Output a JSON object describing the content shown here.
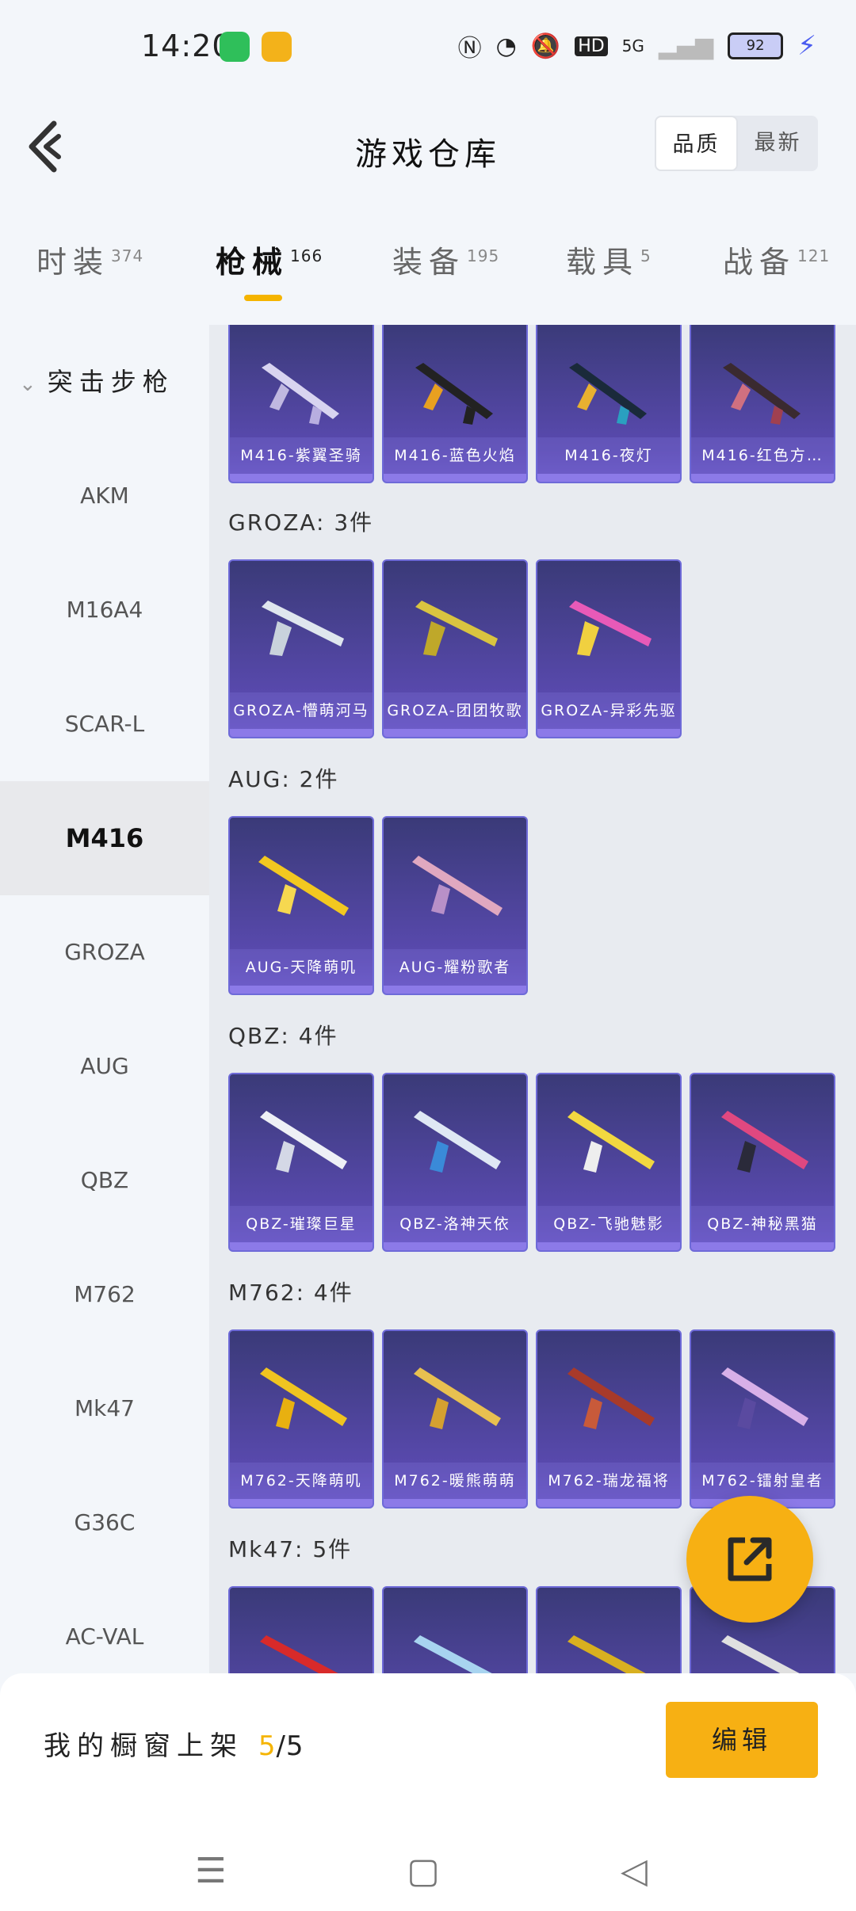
{
  "status_bar": {
    "time": "14:20",
    "battery_level": "92",
    "icons": [
      "messages-app-icon",
      "game-app-icon",
      "nfc-icon",
      "speed-icon",
      "mute-icon",
      "hd-icon",
      "signal-5g-icon",
      "signal-icon",
      "battery-icon",
      "charging-icon"
    ],
    "hd_label": "HD",
    "net_label": "5G"
  },
  "header": {
    "title": "游戏仓库",
    "sort_options": [
      "品质",
      "最新"
    ],
    "sort_selected": "品质"
  },
  "tabs": [
    {
      "label": "时装",
      "count": "374"
    },
    {
      "label": "枪械",
      "count": "166"
    },
    {
      "label": "装备",
      "count": "195"
    },
    {
      "label": "载具",
      "count": "5"
    },
    {
      "label": "战备",
      "count": "121"
    }
  ],
  "active_tab": "枪械",
  "sidebar": {
    "category": "突击步枪",
    "items": [
      "AKM",
      "M16A4",
      "SCAR-L",
      "M416",
      "GROZA",
      "AUG",
      "QBZ",
      "M762",
      "Mk47",
      "G36C",
      "AC-VAL"
    ],
    "active": "M416"
  },
  "groups": [
    {
      "title": "",
      "items": [
        "M416-紫翼圣骑",
        "M416-蓝色火焰",
        "M416-夜灯",
        "M416-红色方…"
      ]
    },
    {
      "title": "GROZA: 3件",
      "items": [
        "GROZA-懵萌河马",
        "GROZA-团团牧歌",
        "GROZA-异彩先驱"
      ]
    },
    {
      "title": "AUG: 2件",
      "items": [
        "AUG-天降萌叽",
        "AUG-耀粉歌者"
      ]
    },
    {
      "title": "QBZ: 4件",
      "items": [
        "QBZ-璀璨巨星",
        "QBZ-洛神天依",
        "QBZ-飞驰魅影",
        "QBZ-神秘黑猫"
      ]
    },
    {
      "title": "M762: 4件",
      "items": [
        "M762-天降萌叽",
        "M762-暖熊萌萌",
        "M762-瑞龙福将",
        "M762-镭射皇者"
      ]
    },
    {
      "title": "Mk47: 5件",
      "items": [
        "",
        "",
        "",
        ""
      ]
    }
  ],
  "bottom": {
    "showcase_label": "我的橱窗上架",
    "showcase_count": "5",
    "showcase_total": "/5",
    "edit_label": "编辑"
  },
  "colors": {
    "accent": "#f7b013",
    "card": "#4a3f99"
  }
}
